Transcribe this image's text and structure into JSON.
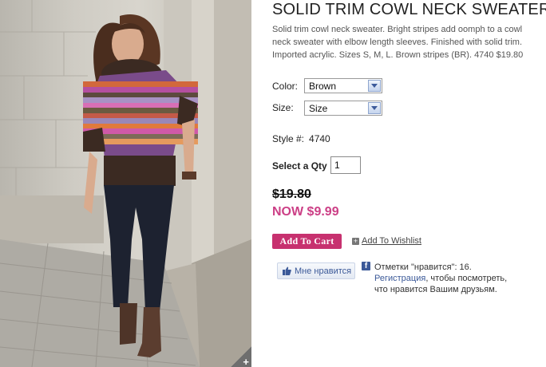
{
  "product": {
    "title": "SOLID TRIM COWL NECK SWEATER",
    "description_lines": [
      "Solid trim cowl neck sweater. Bright stripes add oomph to a cowl",
      "neck sweater with elbow length sleeves. Finished with solid trim.",
      "Imported acrylic. Sizes S, M, L. Brown stripes (BR). 4740 $19.80"
    ],
    "image_alt": "Model wearing striped cowl neck sweater",
    "zoom_icon": "plus-icon",
    "zoom_glyph": "+"
  },
  "options": {
    "color_label": "Color:",
    "color_value": "Brown",
    "size_label": "Size:",
    "size_value": "Size"
  },
  "style": {
    "label": "Style #:",
    "value": "4740"
  },
  "quantity": {
    "label": "Select a Qty",
    "value": "1"
  },
  "pricing": {
    "old_price": "$19.80",
    "sale_price": "NOW $9.99"
  },
  "actions": {
    "add_to_cart": "Add To Cart",
    "add_to_wishlist": "Add To Wishlist",
    "wishlist_icon_glyph": "+"
  },
  "facebook": {
    "like_button": "Мне нравится",
    "icon_glyph": "f",
    "count_text": "Отметки \"нравится\": 16.",
    "register_link": "Регистрация",
    "register_rest": ", чтобы посмотреть,",
    "friends_text": "что нравится Вашим друзьям."
  },
  "colors": {
    "accent_pink": "#cc3f86",
    "cart_button": "#c7316f",
    "facebook_blue": "#3b5998"
  }
}
